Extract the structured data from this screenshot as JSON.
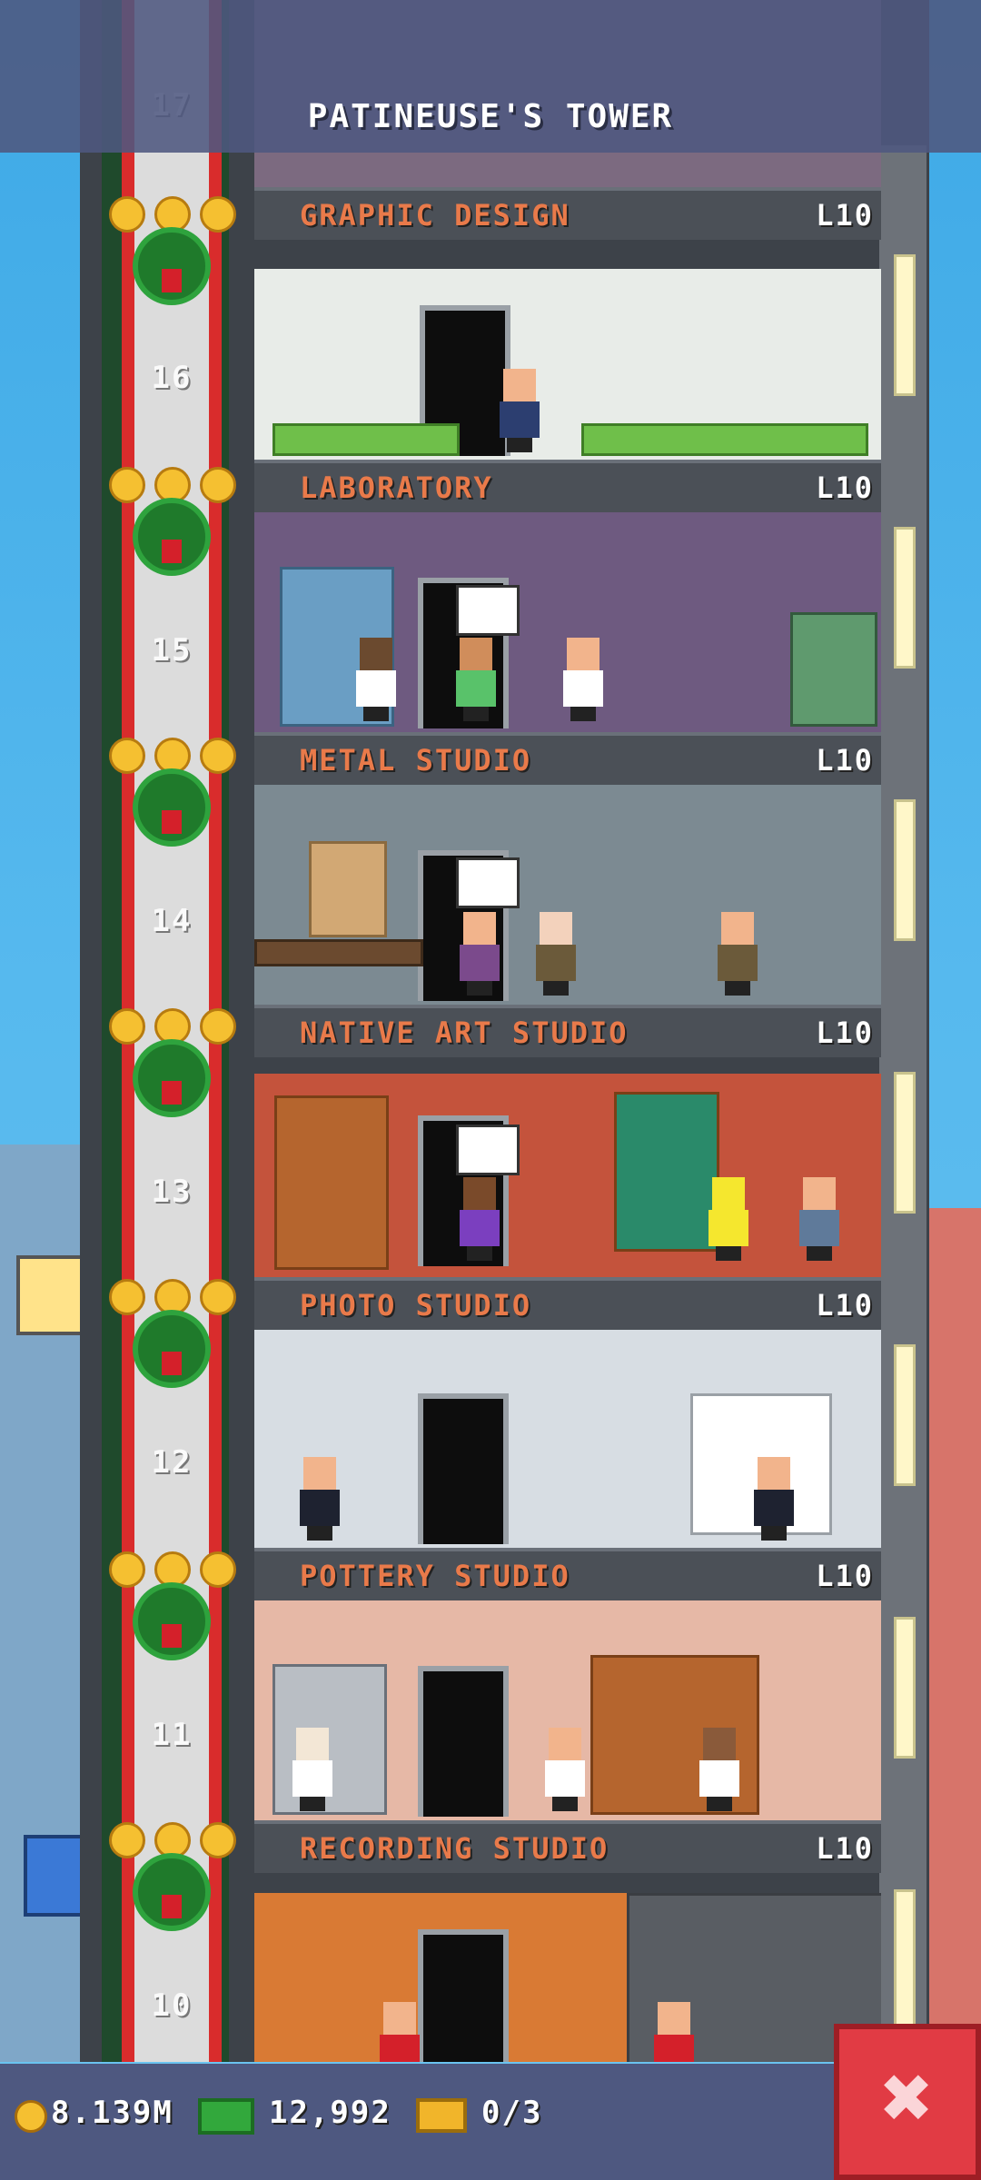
{
  "header": {
    "title": "PATINEUSE'S TOWER"
  },
  "floors": [
    {
      "number": "17",
      "name": "GRAPHIC DESIGN",
      "level": "L10"
    },
    {
      "number": "16",
      "name": "LABORATORY",
      "level": "L10"
    },
    {
      "number": "15",
      "name": "METAL STUDIO",
      "level": "L10"
    },
    {
      "number": "14",
      "name": "NATIVE ART STUDIO",
      "level": "L10"
    },
    {
      "number": "13",
      "name": "PHOTO STUDIO",
      "level": "L10"
    },
    {
      "number": "12",
      "name": "POTTERY STUDIO",
      "level": "L10"
    },
    {
      "number": "11",
      "name": "RECORDING STUDIO",
      "level": "L10"
    },
    {
      "number": "10"
    }
  ],
  "status_bar": {
    "coins": "8.139M",
    "bux": "12,992",
    "tickets": "0/3"
  },
  "colors": {
    "header_bg": "#4e5880",
    "floor_name": "#e97a4a",
    "close_button": "#e13b44"
  }
}
